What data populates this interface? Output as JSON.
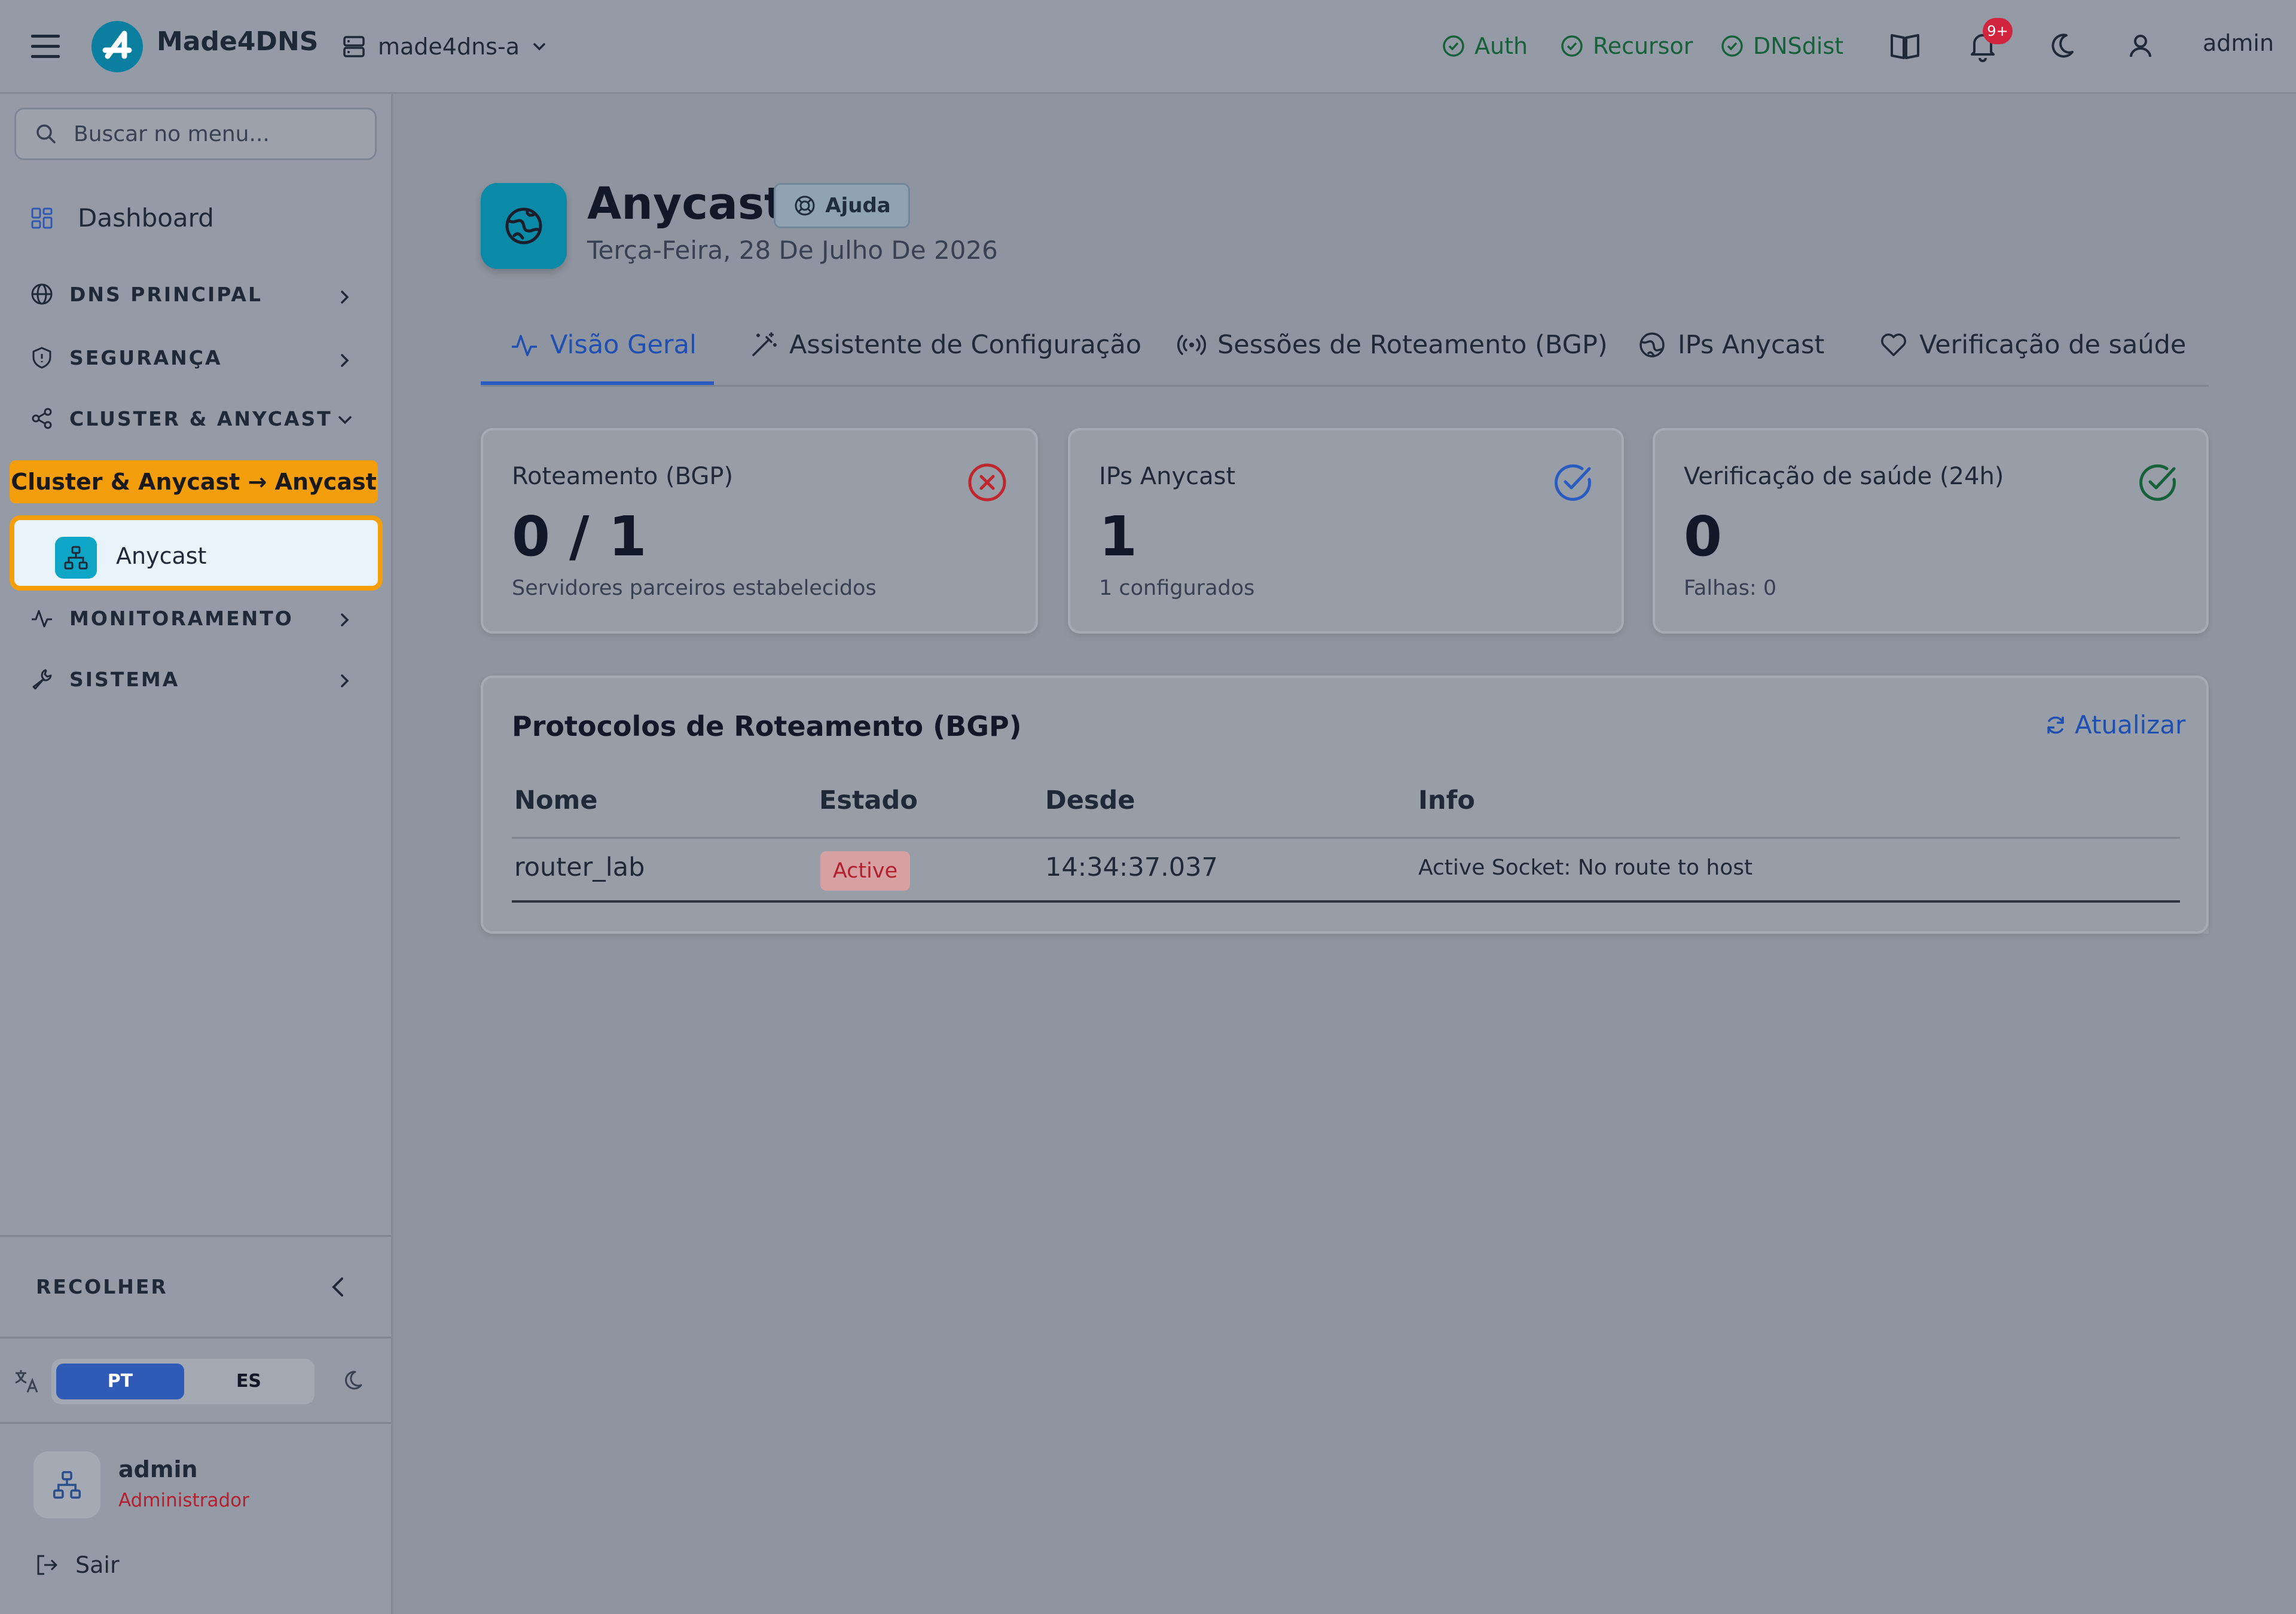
{
  "topbar": {
    "brand": "Made4DNS",
    "server": "made4dns-a",
    "services": [
      {
        "label": "Auth"
      },
      {
        "label": "Recursor"
      },
      {
        "label": "DNSdist"
      }
    ],
    "notification_count": "9+",
    "user": "admin"
  },
  "sidebar": {
    "search_placeholder": "Buscar no menu...",
    "dashboard": "Dashboard",
    "sections": [
      {
        "label": "DNS PRINCIPAL"
      },
      {
        "label": "SEGURANÇA"
      },
      {
        "label": "CLUSTER & ANYCAST"
      },
      {
        "label": "MONITORAMENTO"
      },
      {
        "label": "SISTEMA"
      }
    ],
    "tooltip": "Cluster & Anycast → Anycast",
    "active_item": "Anycast",
    "collapse_label": "RECOLHER",
    "languages": {
      "pt": "PT",
      "es": "ES",
      "selected": "PT"
    },
    "user": {
      "name": "admin",
      "role": "Administrador"
    },
    "logout": "Sair"
  },
  "page": {
    "title": "Anycast",
    "help": "Ajuda",
    "date": "Terça-Feira, 28 De Julho De 2026",
    "tabs": [
      {
        "label": "Visão Geral",
        "active": true
      },
      {
        "label": "Assistente de Configuração"
      },
      {
        "label": "Sessões de Roteamento (BGP)"
      },
      {
        "label": "IPs Anycast"
      },
      {
        "label": "Verificação de saúde"
      }
    ],
    "cards": [
      {
        "title": "Roteamento (BGP)",
        "value": "0 / 1",
        "subtitle": "Servidores parceiros estabelecidos",
        "status": "error"
      },
      {
        "title": "IPs Anycast",
        "value": "1",
        "subtitle": "1 configurados",
        "status": "ok"
      },
      {
        "title": "Verificação de saúde (24h)",
        "value": "0",
        "subtitle": "Falhas: 0",
        "status": "ok"
      }
    ],
    "bgp_table": {
      "title": "Protocolos de Roteamento (BGP)",
      "refresh": "Atualizar",
      "columns": [
        "Nome",
        "Estado",
        "Desde",
        "Info"
      ],
      "rows": [
        {
          "name": "router_lab",
          "state": "Active",
          "since": "14:34:37.037",
          "info": "Active Socket: No route to host"
        }
      ]
    }
  },
  "colors": {
    "accent": "#2a5bbf",
    "brand_teal": "#0b8aa8",
    "highlight": "#f59e0b",
    "error": "#c0262d",
    "success": "#16613a"
  }
}
